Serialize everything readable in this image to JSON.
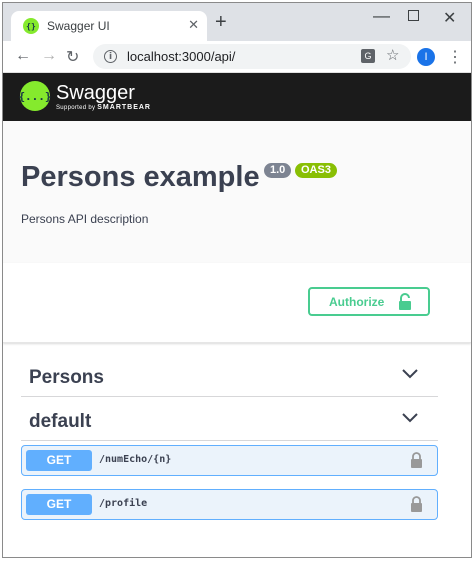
{
  "browser": {
    "tab_title": "Swagger UI",
    "url": "localhost:3000/api/",
    "profile_initial": "I",
    "icons": [
      "back-arrow-icon",
      "forward-arrow-icon",
      "reload-icon",
      "info-icon",
      "translate-icon",
      "star-icon",
      "menu-icon"
    ]
  },
  "swagger": {
    "brand": "Swagger",
    "supported_by": "Supported by",
    "supported_by_brand": "SMARTBEAR",
    "logo_glyph": "{...}",
    "brand_color": "#85ea2d"
  },
  "info": {
    "title": "Persons example",
    "version": "1.0",
    "spec": "OAS3",
    "description": "Persons API description"
  },
  "auth": {
    "button_label": "Authorize",
    "color": "#49cc90"
  },
  "tags": [
    {
      "name": "Persons"
    },
    {
      "name": "default"
    }
  ],
  "operations": [
    {
      "method": "GET",
      "path": "/numEcho/{n}"
    },
    {
      "method": "GET",
      "path": "/profile"
    }
  ],
  "colors": {
    "get": "#61affe",
    "get_bg": "#ebf3fb",
    "text": "#3b4151"
  }
}
